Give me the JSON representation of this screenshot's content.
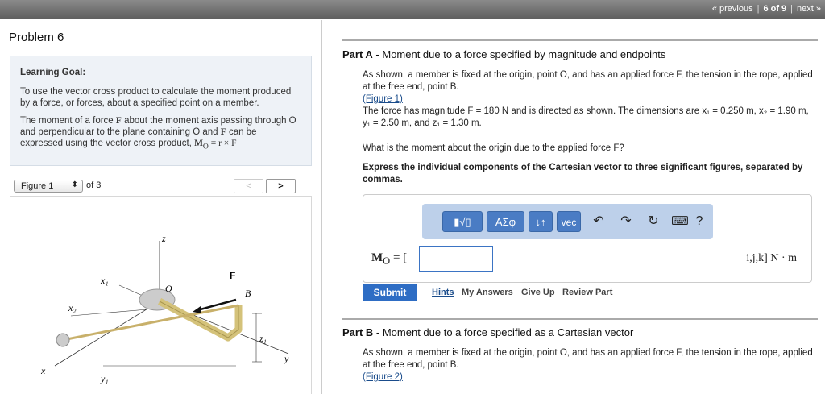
{
  "topnav": {
    "previous": "« previous",
    "position": "6 of 9",
    "next": "next »"
  },
  "problem": {
    "title": "Problem 6"
  },
  "goal": {
    "title": "Learning Goal:",
    "p1": "To use the vector cross product to calculate the moment produced by a force, or forces, about a specified point on a member.",
    "p2_a": "The moment of a force ",
    "p2_F": "F",
    "p2_b": " about the moment axis passing through O and perpendicular to the plane containing O and ",
    "p2_F2": "F",
    "p2_c": " can be expressed using the vector cross product, ",
    "p2_eq": "M",
    "p2_sub": "O",
    "p2_eq2": " = r × F"
  },
  "figure_nav": {
    "selected": "Figure 1",
    "of": "of 3",
    "prev": "<",
    "next": ">"
  },
  "figure": {
    "labels": {
      "z": "z",
      "x": "x",
      "y": "y",
      "x1": "x₁",
      "x2": "x₂",
      "y1": "y₁",
      "z1": "z₁",
      "O": "O",
      "B": "B",
      "F": "F"
    }
  },
  "partA": {
    "title_bold": "Part A",
    "title_rest": " - Moment due to a force specified by magnitude and endpoints",
    "text1": "As shown, a member is fixed at the origin, point O, and has an applied force F, the tension in the rope, applied at the free end, point B.",
    "figure_link": "(Figure 1)",
    "text2": "The force has magnitude F = 180 N and is directed as shown. The dimensions are x₁ = 0.250 m, x₂ = 1.90 m, y₁ = 2.50 m, and z₁ = 1.30 m.",
    "question": "What is the moment about the origin due to the applied force F?",
    "instruction": "Express the individual components of the Cartesian vector to three significant figures, separated by commas.",
    "toolbar": {
      "templates": "▮√▯",
      "greek": "ΑΣφ",
      "sort": "↓↑",
      "vec": "vec",
      "undo": "↶",
      "redo": "↷",
      "reset": "↻",
      "keyboard": "⌨",
      "help": "?"
    },
    "answer_label": "M",
    "answer_sub": "O",
    "answer_eq": " = [",
    "answer_value": "",
    "units": "i,j,k] N · m",
    "submit": "Submit",
    "hints": "Hints",
    "my_answers": "My Answers",
    "give_up": "Give Up",
    "review": "Review Part"
  },
  "partB": {
    "title_bold": "Part B",
    "title_rest": " - Moment due to a force specified as a Cartesian vector",
    "text1": "As shown, a member is fixed at the origin, point O, and has an applied force F, the tension in the rope, applied at the free end, point B.",
    "figure_link": "(Figure 2)"
  }
}
